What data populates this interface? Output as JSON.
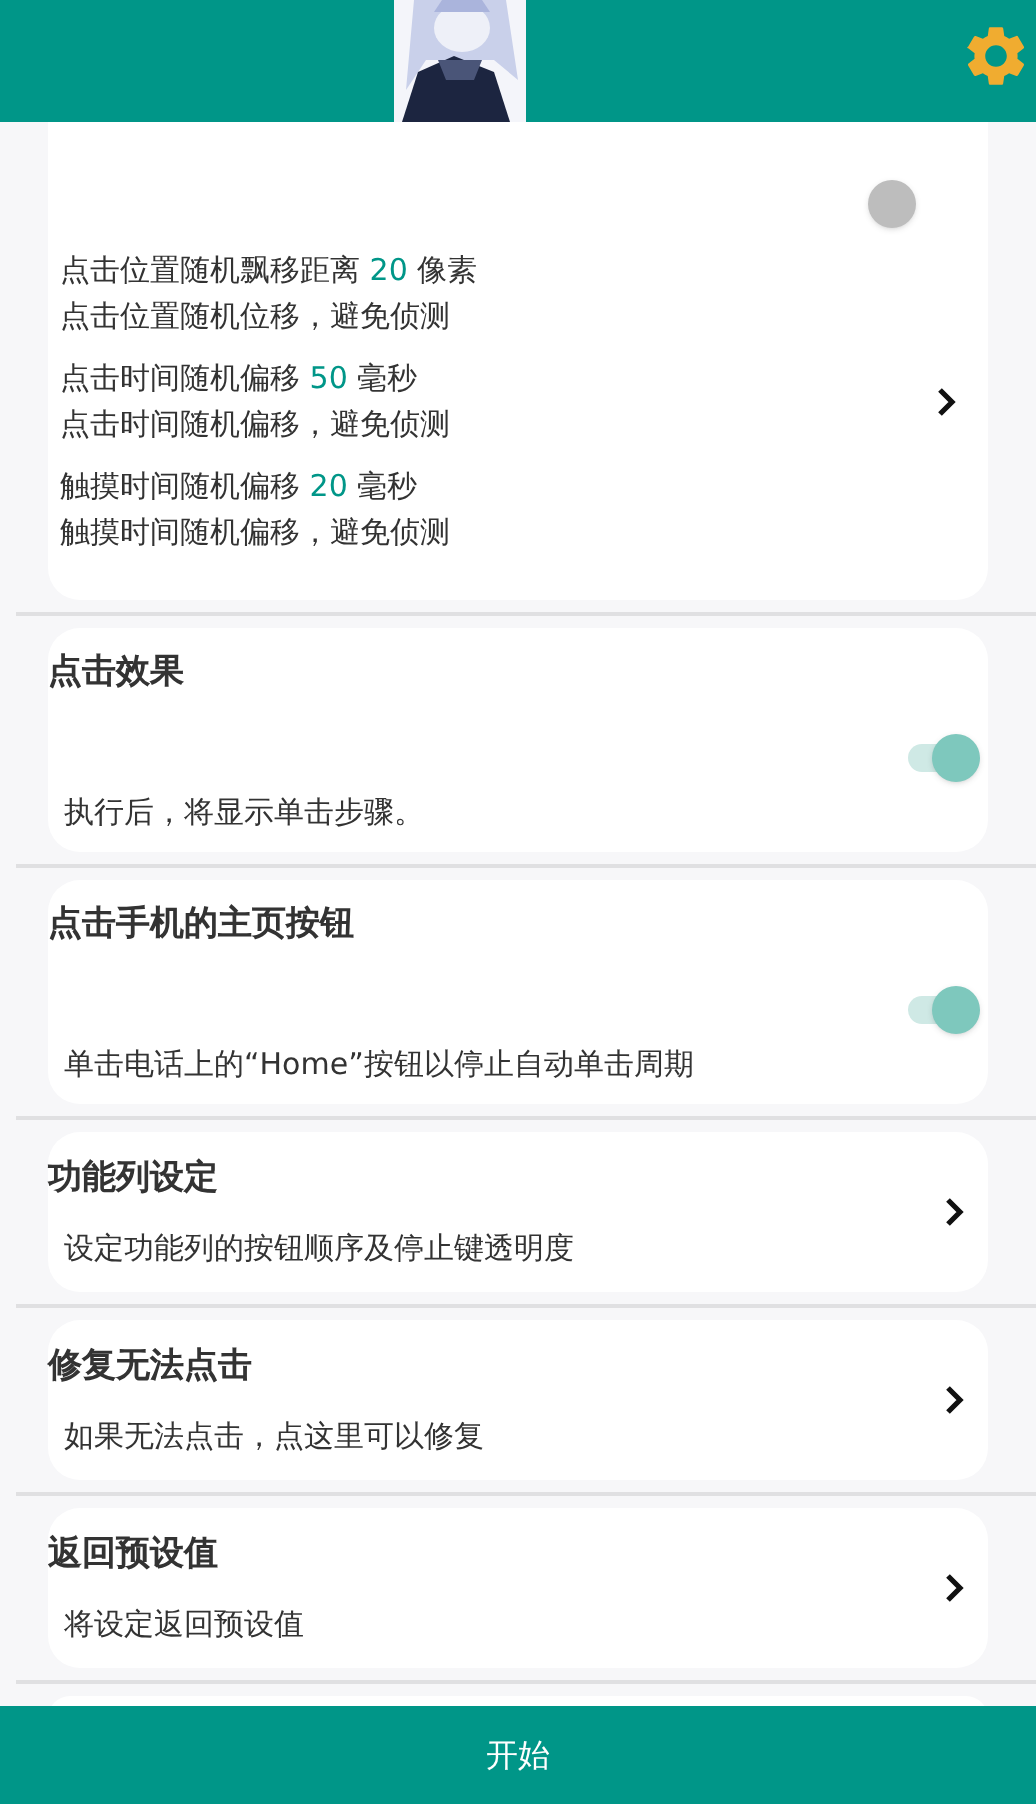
{
  "cards": [
    {
      "kind": "toggle_detail",
      "on": false,
      "details": [
        {
          "label": "点击位置随机飘移距离",
          "value": "20",
          "unit": "像素",
          "description": "点击位置随机位移，避免侦测"
        },
        {
          "label": "点击时间随机偏移",
          "value": "50",
          "unit": "毫秒",
          "description": "点击时间随机偏移，避免侦测"
        },
        {
          "label": "触摸时间随机偏移",
          "value": "20",
          "unit": "毫秒",
          "description": "触摸时间随机偏移，避免侦测"
        }
      ]
    },
    {
      "kind": "toggle",
      "title": "点击效果",
      "on": true,
      "description": "执行后，将显示单击步骤。"
    },
    {
      "kind": "toggle",
      "title": "点击手机的主页按钮",
      "on": true,
      "description": "单击电话上的“Home”按钮以停止自动单击周期"
    },
    {
      "kind": "link",
      "title": "功能列设定",
      "description": "设定功能列的按钮顺序及停止键透明度"
    },
    {
      "kind": "link",
      "title": "修复无法点击",
      "description": "如果无法点击，点这里可以修复"
    },
    {
      "kind": "link",
      "title": "返回预设值",
      "description": "将设定返回预设值"
    },
    {
      "kind": "empty"
    }
  ],
  "start_button": "开始"
}
